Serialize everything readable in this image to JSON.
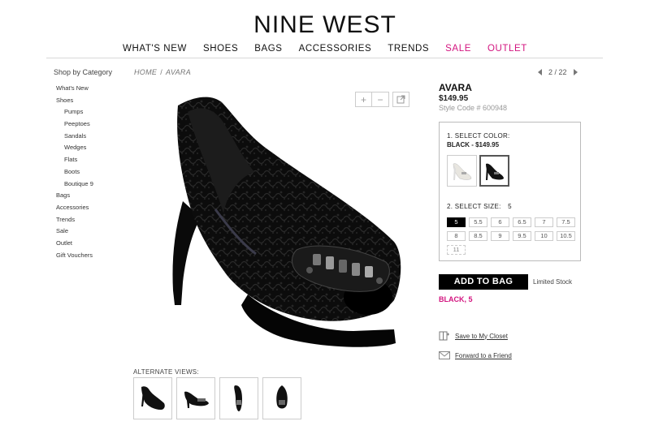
{
  "brand": {
    "logo": "NINE WEST"
  },
  "nav": [
    {
      "label": "WHAT'S NEW",
      "highlight": false
    },
    {
      "label": "SHOES",
      "highlight": false
    },
    {
      "label": "BAGS",
      "highlight": false
    },
    {
      "label": "ACCESSORIES",
      "highlight": false
    },
    {
      "label": "TRENDS",
      "highlight": false
    },
    {
      "label": "SALE",
      "highlight": true
    },
    {
      "label": "OUTLET",
      "highlight": true
    }
  ],
  "sidebar": {
    "title": "Shop by Category",
    "items": [
      {
        "label": "What's New",
        "sub": false
      },
      {
        "label": "Shoes",
        "sub": false
      },
      {
        "label": "Pumps",
        "sub": true
      },
      {
        "label": "Peeptoes",
        "sub": true
      },
      {
        "label": "Sandals",
        "sub": true
      },
      {
        "label": "Wedges",
        "sub": true
      },
      {
        "label": "Flats",
        "sub": true
      },
      {
        "label": "Boots",
        "sub": true
      },
      {
        "label": "Boutique 9",
        "sub": true
      },
      {
        "label": "Bags",
        "sub": false
      },
      {
        "label": "Accessories",
        "sub": false
      },
      {
        "label": "Trends",
        "sub": false
      },
      {
        "label": "Sale",
        "sub": false
      },
      {
        "label": "Outlet",
        "sub": false
      },
      {
        "label": "Gift Vouchers",
        "sub": false
      }
    ]
  },
  "breadcrumb": {
    "home": "HOME",
    "sep": "/",
    "current": "AVARA"
  },
  "pager": {
    "text": "2 / 22"
  },
  "product": {
    "name": "AVARA",
    "price": "$149.95",
    "style_code": "Style Code # 600948"
  },
  "options": {
    "color_label": "1. SELECT COLOR:",
    "color_value": "BLACK - $149.95",
    "size_label": "2. SELECT SIZE:",
    "size_value": "5",
    "sizes": [
      {
        "label": "5",
        "selected": true,
        "available": true
      },
      {
        "label": "5.5",
        "selected": false,
        "available": true
      },
      {
        "label": "6",
        "selected": false,
        "available": true
      },
      {
        "label": "6.5",
        "selected": false,
        "available": true
      },
      {
        "label": "7",
        "selected": false,
        "available": true
      },
      {
        "label": "7.5",
        "selected": false,
        "available": true
      },
      {
        "label": "8",
        "selected": false,
        "available": true
      },
      {
        "label": "8.5",
        "selected": false,
        "available": true
      },
      {
        "label": "9",
        "selected": false,
        "available": true
      },
      {
        "label": "9.5",
        "selected": false,
        "available": true
      },
      {
        "label": "10",
        "selected": false,
        "available": true
      },
      {
        "label": "10.5",
        "selected": false,
        "available": true
      },
      {
        "label": "11",
        "selected": false,
        "available": false
      }
    ]
  },
  "cart": {
    "add_label": "ADD TO BAG",
    "stock": "Limited Stock",
    "selection": "BLACK, 5"
  },
  "actions": {
    "save": "Save to My Closet",
    "forward": "Forward to a Friend"
  },
  "alternate": {
    "label": "ALTERNATE VIEWS:"
  },
  "colors": {
    "accent": "#d3147f",
    "primary": "#000000"
  }
}
